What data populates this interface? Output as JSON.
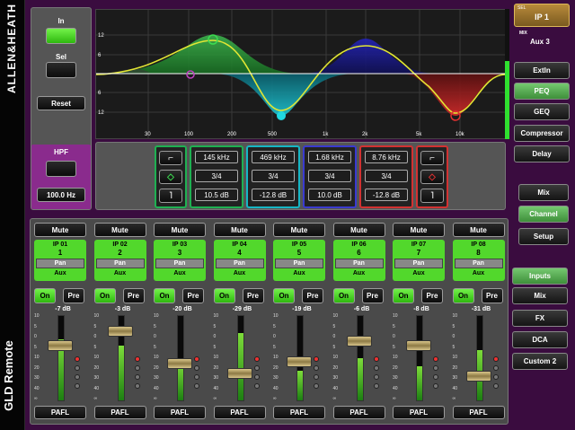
{
  "brand": "ALLEN&HEATH",
  "app_name": "GLD Remote",
  "sel_box": {
    "title": "SEL",
    "value": "IP 1",
    "mix_title": "MIX",
    "mix_value": "Aux 3"
  },
  "left_panel": {
    "in": "In",
    "sel": "Sel",
    "reset": "Reset",
    "hpf": "HPF",
    "hpf_value": "100.0 Hz"
  },
  "proc_nav": [
    {
      "label": "Extln",
      "selected": false
    },
    {
      "label": "PEQ",
      "selected": true
    },
    {
      "label": "GEQ",
      "selected": false
    },
    {
      "label": "Compressor",
      "selected": false
    },
    {
      "label": "Delay",
      "selected": false
    }
  ],
  "view_nav": [
    {
      "label": "Mix",
      "selected": false
    },
    {
      "label": "Channel",
      "selected": true
    },
    {
      "label": "Setup",
      "selected": false
    }
  ],
  "layer_nav": [
    {
      "label": "Inputs",
      "selected": true
    },
    {
      "label": "Mix",
      "selected": false
    },
    {
      "label": "FX",
      "selected": false
    },
    {
      "label": "DCA",
      "selected": false
    },
    {
      "label": "Custom 2",
      "selected": false
    }
  ],
  "eq": {
    "y_ticks": [
      "12",
      "6",
      "6",
      "12"
    ],
    "x_ticks": [
      "30",
      "100",
      "200",
      "500",
      "1k",
      "2k",
      "5k",
      "10k"
    ],
    "bands": [
      {
        "freq": "145 kHz",
        "width": "3/4",
        "gain": "10.5 dB",
        "color": "#1fb052"
      },
      {
        "freq": "469 kHz",
        "width": "3/4",
        "gain": "-12.8 dB",
        "color": "#16b6c4"
      },
      {
        "freq": "1.68 kHz",
        "width": "3/4",
        "gain": "10.0 dB",
        "color": "#3a3ad0"
      },
      {
        "freq": "8.76 kHz",
        "width": "3/4",
        "gain": "-12.8 dB",
        "color": "#d23232"
      }
    ]
  },
  "strip_labels": {
    "mute": "Mute",
    "pan": "Pan",
    "aux": "Aux",
    "on": "On",
    "pre": "Pre",
    "pafl": "PAFL"
  },
  "channels": [
    {
      "id": "IP 01",
      "num": "1",
      "db": "-7 dB",
      "fader": 0.62,
      "meter": 0.72
    },
    {
      "id": "IP 02",
      "num": "2",
      "db": "-3 dB",
      "fader": 0.8,
      "meter": 0.65
    },
    {
      "id": "IP 03",
      "num": "3",
      "db": "-20 dB",
      "fader": 0.4,
      "meter": 0.45
    },
    {
      "id": "IP 04",
      "num": "4",
      "db": "-29 dB",
      "fader": 0.28,
      "meter": 0.8
    },
    {
      "id": "IP 05",
      "num": "5",
      "db": "-19 dB",
      "fader": 0.42,
      "meter": 0.35
    },
    {
      "id": "IP 06",
      "num": "6",
      "db": "-6 dB",
      "fader": 0.68,
      "meter": 0.5
    },
    {
      "id": "IP 07",
      "num": "7",
      "db": "-8 dB",
      "fader": 0.62,
      "meter": 0.4
    },
    {
      "id": "IP 08",
      "num": "8",
      "db": "-31 dB",
      "fader": 0.25,
      "meter": 0.6
    }
  ],
  "fader_scale": [
    "10",
    "5",
    "0",
    "5",
    "10",
    "20",
    "30",
    "40",
    "∞"
  ]
}
